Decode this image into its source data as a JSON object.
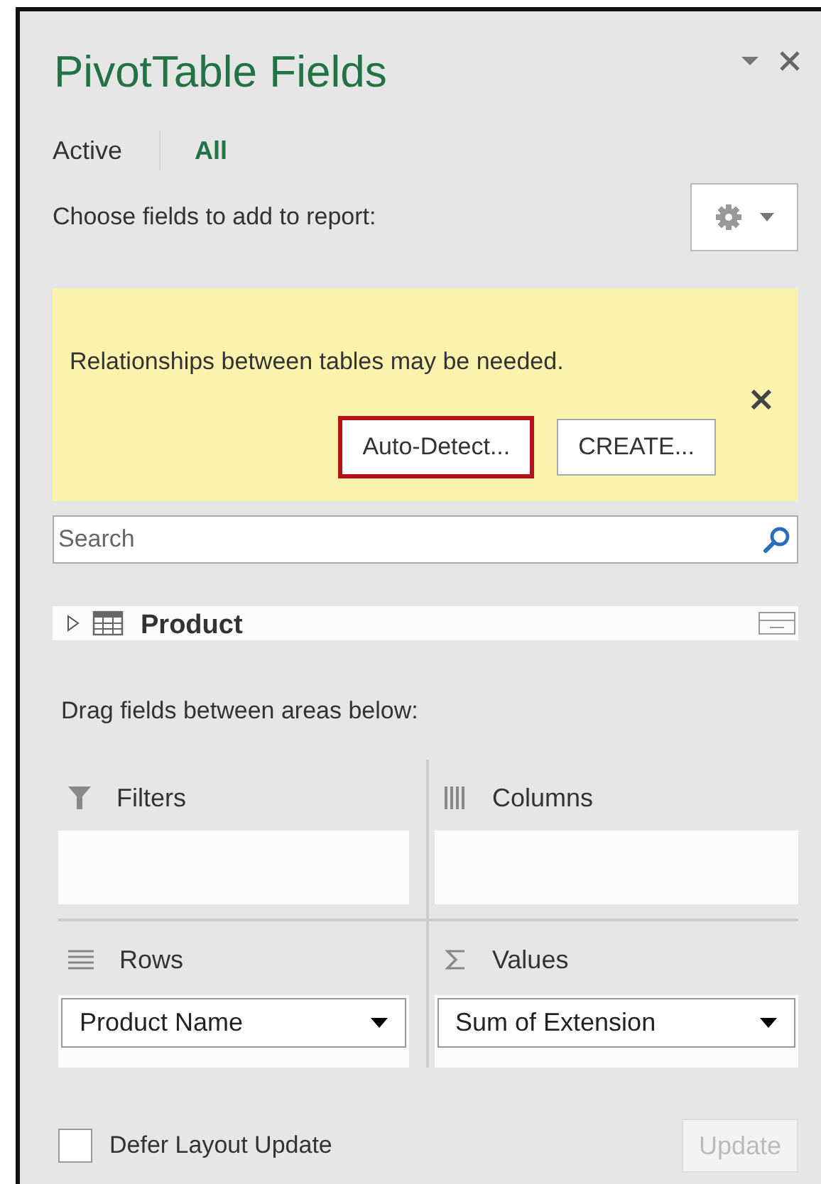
{
  "pane": {
    "title": "PivotTable Fields"
  },
  "tabs": [
    {
      "label": "Active",
      "selected": false
    },
    {
      "label": "All",
      "selected": true
    }
  ],
  "choose_label": "Choose fields to add to report:",
  "banner": {
    "message": "Relationships between tables may be needed.",
    "close": "×",
    "buttons": [
      {
        "label": "Auto-Detect...",
        "highlighted": true
      },
      {
        "label": "CREATE...",
        "highlighted": false
      }
    ]
  },
  "search": {
    "placeholder": "Search"
  },
  "field_list": [
    {
      "name": "Product",
      "expanded": false
    }
  ],
  "areas_label": "Drag fields between areas below:",
  "areas": [
    {
      "kind": "filters",
      "label": "Filters"
    },
    {
      "kind": "columns",
      "label": "Columns"
    },
    {
      "kind": "rows",
      "label": "Rows",
      "fields": [
        "Product Name"
      ]
    },
    {
      "kind": "values",
      "label": "Values",
      "fields": [
        "Sum of Extension"
      ]
    }
  ],
  "defer": {
    "label": "Defer Layout Update",
    "checked": false
  },
  "update_button": {
    "label": "Update",
    "disabled": true
  }
}
